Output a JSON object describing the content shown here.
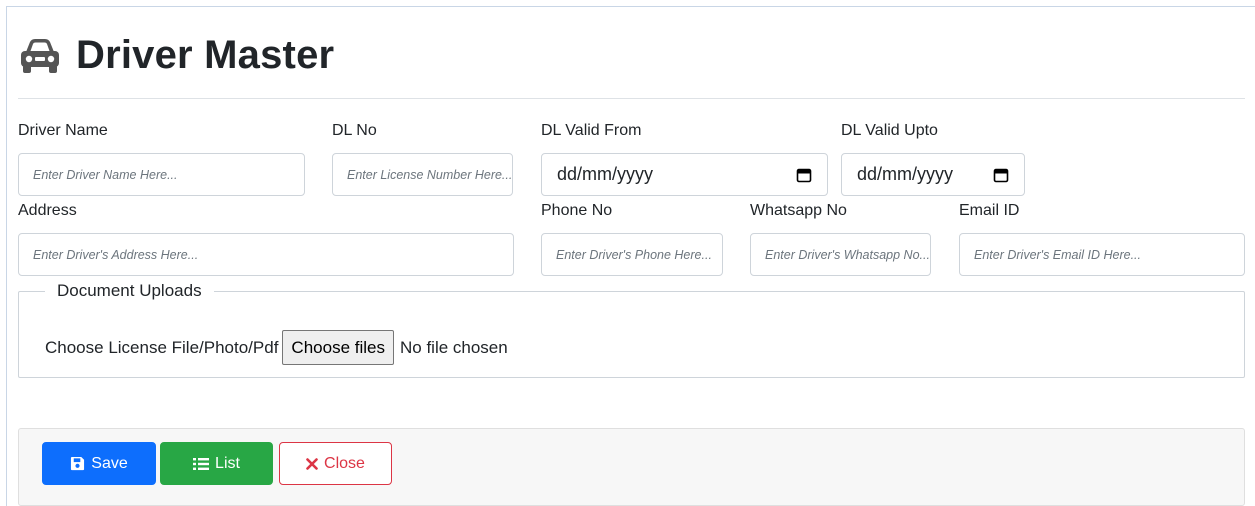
{
  "header": {
    "title": "Driver Master",
    "icon": "car-icon"
  },
  "form": {
    "driver_name": {
      "label": "Driver Name",
      "placeholder": "Enter Driver Name Here..."
    },
    "dl_no": {
      "label": "DL No",
      "placeholder": "Enter License Number Here..."
    },
    "dl_valid_from": {
      "label": "DL Valid From",
      "value": "dd/mm/yyyy"
    },
    "dl_valid_upto": {
      "label": "DL Valid Upto",
      "value": "dd/mm/yyyy"
    },
    "address": {
      "label": "Address",
      "placeholder": "Enter Driver's Address Here..."
    },
    "phone_no": {
      "label": "Phone No",
      "placeholder": "Enter Driver's Phone Here..."
    },
    "whatsapp_no": {
      "label": "Whatsapp No",
      "placeholder": "Enter Driver's Whatsapp No..."
    },
    "email_id": {
      "label": "Email ID",
      "placeholder": "Enter Driver's Email ID Here..."
    }
  },
  "documents": {
    "legend": "Document Uploads",
    "file_label": "Choose License File/Photo/Pdf",
    "button_label": "Choose files",
    "status": "No file chosen"
  },
  "actions": {
    "save_label": "Save",
    "list_label": "List",
    "close_label": "Close"
  },
  "colors": {
    "save": "#0d6efd",
    "list": "#28a745",
    "close": "#dc3545",
    "title_icon": "#555555"
  }
}
